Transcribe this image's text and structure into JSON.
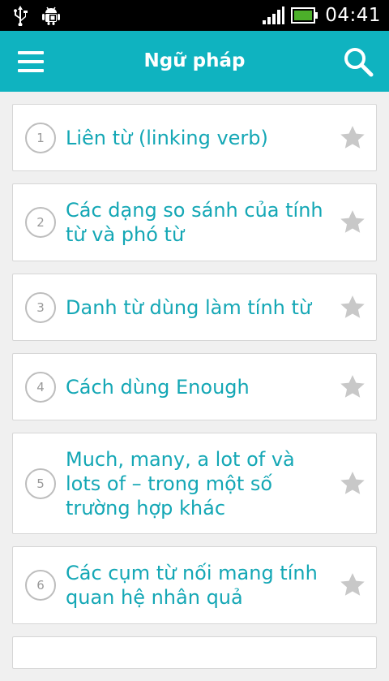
{
  "status_bar": {
    "time": "04:41",
    "icons": [
      "usb-icon",
      "android-debug-icon",
      "signal-icon",
      "battery-icon"
    ],
    "battery_color": "#4caf2a"
  },
  "app_bar": {
    "title": "Ngữ pháp",
    "background": "#0fb3c0",
    "icons": [
      "menu-icon",
      "search-icon"
    ]
  },
  "colors": {
    "accent_text": "#14a7b5",
    "star": "#c8c8c8",
    "circle_border": "#bdbdbd"
  },
  "items": [
    {
      "number": "1",
      "title": "Liên từ (linking verb)"
    },
    {
      "number": "2",
      "title": "Các dạng so sánh của tính từ và phó từ"
    },
    {
      "number": "3",
      "title": "Danh từ dùng làm tính từ"
    },
    {
      "number": "4",
      "title": "Cách dùng Enough"
    },
    {
      "number": "5",
      "title": "Much, many, a lot of và lots of – trong một số trường hợp khác"
    },
    {
      "number": "6",
      "title": "Các cụm từ nối mang tính quan hệ nhân quả"
    }
  ]
}
